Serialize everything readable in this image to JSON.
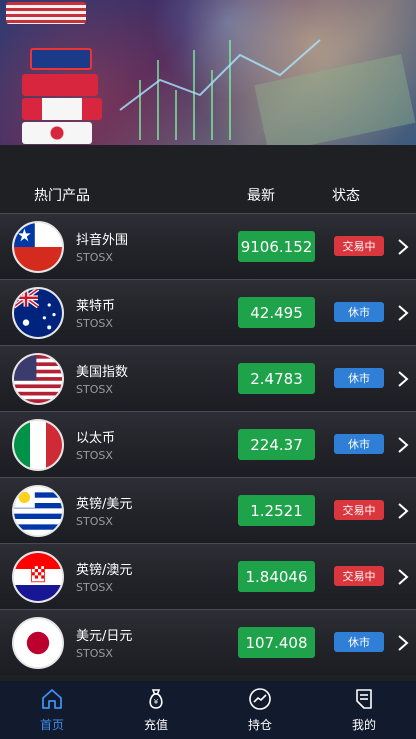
{
  "header": {
    "col_name": "热门产品",
    "col_latest": "最新",
    "col_status": "状态"
  },
  "products": [
    {
      "name": "抖音外围",
      "code": "STOSX",
      "price": "9106.152",
      "status": "交易中",
      "status_type": "trading",
      "flag": "chile"
    },
    {
      "name": "莱特币",
      "code": "STOSX",
      "price": "42.495",
      "status": "休市",
      "status_type": "closed",
      "flag": "australia"
    },
    {
      "name": "美国指数",
      "code": "STOSX",
      "price": "2.4783",
      "status": "休市",
      "status_type": "closed",
      "flag": "usa"
    },
    {
      "name": "以太币",
      "code": "STOSX",
      "price": "224.37",
      "status": "休市",
      "status_type": "closed",
      "flag": "italy"
    },
    {
      "name": "英镑/美元",
      "code": "STOSX",
      "price": "1.2521",
      "status": "交易中",
      "status_type": "trading",
      "flag": "uruguay"
    },
    {
      "name": "英镑/澳元",
      "code": "STOSX",
      "price": "1.84046",
      "status": "交易中",
      "status_type": "trading",
      "flag": "croatia"
    },
    {
      "name": "美元/日元",
      "code": "STOSX",
      "price": "107.408",
      "status": "休市",
      "status_type": "closed",
      "flag": "japan"
    }
  ],
  "tabbar": {
    "home": "首页",
    "recharge": "充值",
    "positions": "持仓",
    "mine": "我的"
  },
  "colors": {
    "price_bg": "#1fa34a",
    "trading": "#d9363e",
    "closed": "#2f7fd6",
    "active_tab": "#3f8ef0"
  }
}
